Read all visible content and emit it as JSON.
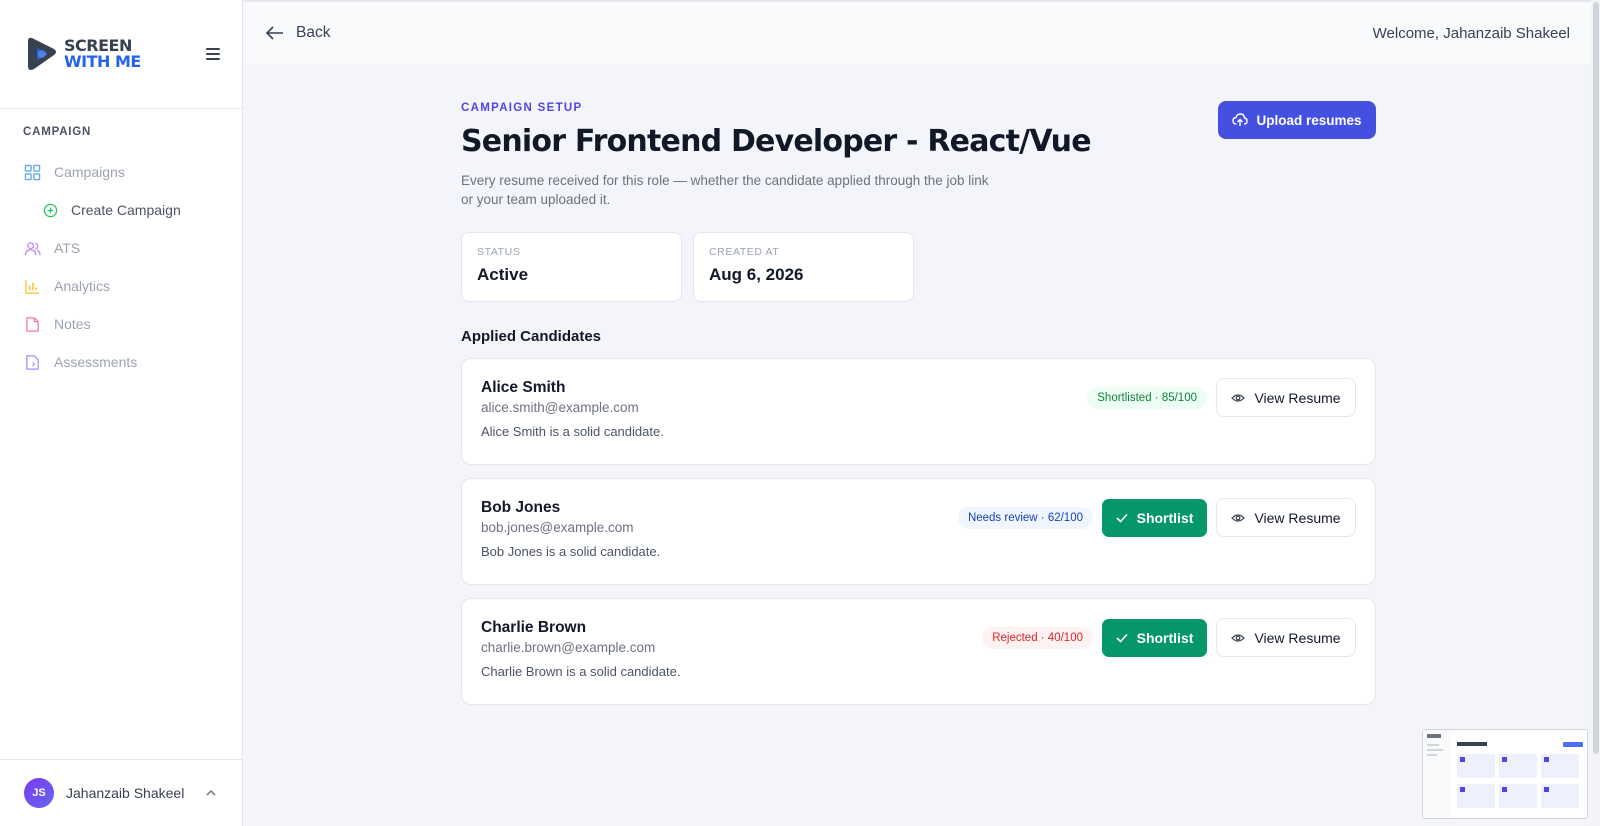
{
  "brand": {
    "line1": "SCREEN",
    "line2": "WITH ME"
  },
  "sidebar": {
    "section_label": "CAMPAIGN",
    "items": [
      {
        "label": "Campaigns",
        "icon": "grid-icon",
        "color": "#60a5fa"
      },
      {
        "label": "Create Campaign",
        "icon": "plus-circle-icon",
        "color": "#22c55e"
      },
      {
        "label": "ATS",
        "icon": "users-icon",
        "color": "#c084fc"
      },
      {
        "label": "Analytics",
        "icon": "bar-chart-icon",
        "color": "#fbbf24"
      },
      {
        "label": "Notes",
        "icon": "note-icon",
        "color": "#f472b6"
      },
      {
        "label": "Assessments",
        "icon": "document-icon",
        "color": "#a78bfa"
      }
    ],
    "user": {
      "initials": "JS",
      "name": "Jahanzaib Shakeel"
    }
  },
  "topbar": {
    "back_label": "Back",
    "welcome": "Welcome, Jahanzaib Shakeel"
  },
  "campaign": {
    "kicker": "CAMPAIGN SETUP",
    "title": "Senior Frontend Developer - React/Vue",
    "description": "Every resume received for this role — whether the candidate applied through the job link or your team uploaded it.",
    "upload_label": "Upload resumes",
    "stats": [
      {
        "label": "STATUS",
        "value": "Active"
      },
      {
        "label": "CREATED AT",
        "value": "Aug 6, 2026"
      }
    ]
  },
  "candidates_section": {
    "title": "Applied Candidates",
    "shortlist_label": "Shortlist",
    "view_label": "View Resume",
    "candidates": [
      {
        "name": "Alice Smith",
        "email": "alice.smith@example.com",
        "note": "Alice Smith is a solid candidate.",
        "badge": "Shortlisted · 85/100",
        "badge_color": "green",
        "show_shortlist": false
      },
      {
        "name": "Bob Jones",
        "email": "bob.jones@example.com",
        "note": "Bob Jones is a solid candidate.",
        "badge": "Needs review · 62/100",
        "badge_color": "blue",
        "show_shortlist": true
      },
      {
        "name": "Charlie Brown",
        "email": "charlie.brown@example.com",
        "note": "Charlie Brown is a solid candidate.",
        "badge": "Rejected · 40/100",
        "badge_color": "red",
        "show_shortlist": true
      }
    ]
  },
  "colors": {
    "accent": "#4451e0",
    "success": "#059669",
    "background": "#f3f5fb"
  }
}
